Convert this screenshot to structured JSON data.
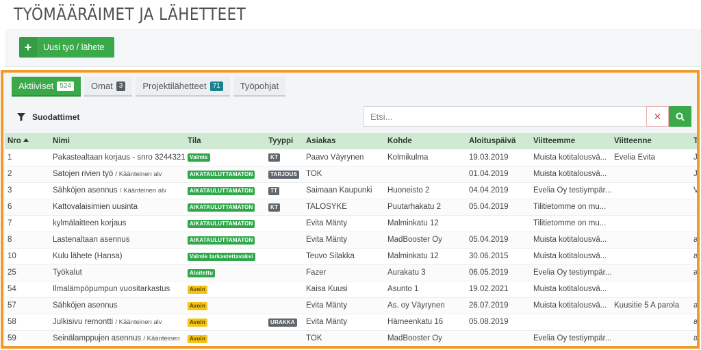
{
  "page": {
    "title": "TYÖMÄÄRÄIMET JA LÄHETTEET"
  },
  "toolbar": {
    "new_button_label": "Uusi työ / lähete"
  },
  "tabs": [
    {
      "label": "Aktiiviset",
      "count": "524"
    },
    {
      "label": "Omat",
      "count": "3"
    },
    {
      "label": "Projektilähetteet",
      "count": "71"
    },
    {
      "label": "Työpohjat"
    }
  ],
  "filters": {
    "label": "Suodattimet"
  },
  "search": {
    "placeholder": "Etsi...",
    "value": ""
  },
  "table": {
    "headers": [
      "Nro",
      "Nimi",
      "Tila",
      "Tyyppi",
      "Asiakas",
      "Kohde",
      "Aloituspäivä",
      "Viitteemme",
      "Viitteenne",
      "Ty"
    ],
    "rows": [
      {
        "nro": "1",
        "nimi": "Pakastealtaan korjaus - snro 3244321",
        "nimi_sub": "",
        "tila": "Valmis",
        "tila_color": "green",
        "tyyppi": "KT",
        "asiakas": "Paavo Väyrynen",
        "kohde": "Kolmikulma",
        "aloitus": "19.03.2019",
        "viitteemme": "Muista kotitalousvä...",
        "viitteenne": "Evelia Evita",
        "ty": "J"
      },
      {
        "nro": "2",
        "nimi": "Satojen rivien työ",
        "nimi_sub": "/ Käänteinen alv",
        "tila": "AIKATAULUTTAMATON",
        "tila_color": "green",
        "tyyppi": "TARJOUS",
        "asiakas": "TOK",
        "kohde": "",
        "aloitus": "01.04.2019",
        "viitteemme": "Muista kotitalousvä...",
        "viitteenne": "",
        "ty": "J"
      },
      {
        "nro": "3",
        "nimi": "Sähköjen asennus",
        "nimi_sub": "/ Käänteinen alv",
        "tila": "AIKATAULUTTAMATON",
        "tila_color": "green",
        "tyyppi": "TT",
        "asiakas": "Saimaan Kaupunki",
        "kohde": "Huoneisto 2",
        "aloitus": "04.04.2019",
        "viitteemme": "Evelia Oy testiympär...",
        "viitteenne": "",
        "ty": "V"
      },
      {
        "nro": "6",
        "nimi": "Kattovalaisimien uusinta",
        "nimi_sub": "",
        "tila": "AIKATAULUTTAMATON",
        "tila_color": "green",
        "tyyppi": "KT",
        "asiakas": "TALOSYKE",
        "kohde": "Puutarhakatu 2",
        "aloitus": "05.04.2019",
        "viitteemme": "Tilitietomme on mu...",
        "viitteenne": "",
        "ty": ""
      },
      {
        "nro": "7",
        "nimi": "kylmälaitteen korjaus",
        "nimi_sub": "",
        "tila": "AIKATAULUTTAMATON",
        "tila_color": "green",
        "tyyppi": "",
        "asiakas": "Evita Mänty",
        "kohde": "Malminkatu 12",
        "aloitus": "",
        "viitteemme": "Tilitietomme on mu...",
        "viitteenne": "",
        "ty": ""
      },
      {
        "nro": "8",
        "nimi": "Lastenaltaan asennus",
        "nimi_sub": "",
        "tila": "AIKATAULUTTAMATON",
        "tila_color": "green",
        "tyyppi": "",
        "asiakas": "Evita Mänty",
        "kohde": "MadBooster Oy",
        "aloitus": "05.04.2019",
        "viitteemme": "Muista kotitalousvä...",
        "viitteenne": "",
        "ty": "a"
      },
      {
        "nro": "10",
        "nimi": "Kulu lähete (Hansa)",
        "nimi_sub": "",
        "tila": "Valmis tarkastettavaksi",
        "tila_color": "green",
        "tyyppi": "",
        "asiakas": "Teuvo Silakka",
        "kohde": "Malminkatu 12",
        "aloitus": "30.06.2015",
        "viitteemme": "Muista kotitalousvä...",
        "viitteenne": "",
        "ty": "a"
      },
      {
        "nro": "25",
        "nimi": "Työkalut",
        "nimi_sub": "",
        "tila": "Aloitettu",
        "tila_color": "green",
        "tyyppi": "",
        "asiakas": "Fazer",
        "kohde": "Aurakatu 3",
        "aloitus": "06.05.2019",
        "viitteemme": "Evelia Oy testiympär...",
        "viitteenne": "",
        "ty": "a"
      },
      {
        "nro": "54",
        "nimi": "Ilmalämpöpumpun vuositarkastus",
        "nimi_sub": "",
        "tila": "Avoin",
        "tila_color": "yellow",
        "tyyppi": "",
        "asiakas": "Kaisa Kuusi",
        "kohde": "Asunto 1",
        "aloitus": "19.02.2021",
        "viitteemme": "Muista kotitalousvä...",
        "viitteenne": "",
        "ty": ""
      },
      {
        "nro": "57",
        "nimi": "Sähköjen asennus",
        "nimi_sub": "",
        "tila": "Avoin",
        "tila_color": "yellow",
        "tyyppi": "",
        "asiakas": "Evita Mänty",
        "kohde": "As. oy Väyrynen",
        "aloitus": "26.07.2019",
        "viitteemme": "Muista kotitalousvä...",
        "viitteenne": "Kuusitie 5 A parola",
        "ty": "a"
      },
      {
        "nro": "58",
        "nimi": "Julkisivu remontti",
        "nimi_sub": "/ Käänteinen alv",
        "tila": "Avoin",
        "tila_color": "yellow",
        "tyyppi": "URAKKA",
        "asiakas": "Evita Mänty",
        "kohde": "Hämeenkatu 16",
        "aloitus": "05.08.2019",
        "viitteemme": "",
        "viitteenne": "",
        "ty": "a"
      },
      {
        "nro": "59",
        "nimi": "Seinälamppujen asennus",
        "nimi_sub": "/ Käänteinen",
        "tila": "Avoin",
        "tila_color": "yellow",
        "tyyppi": "",
        "asiakas": "TOK",
        "kohde": "MadBooster Oy",
        "aloitus": "",
        "viitteemme": "Evelia Oy testiympär...",
        "viitteenne": "",
        "ty": "a"
      }
    ]
  },
  "colors": {
    "accent_green": "#3aa94a",
    "highlight_frame": "#ef9a2b",
    "header_row": "#cfe9d3",
    "badge_yellow": "#f3c416"
  }
}
